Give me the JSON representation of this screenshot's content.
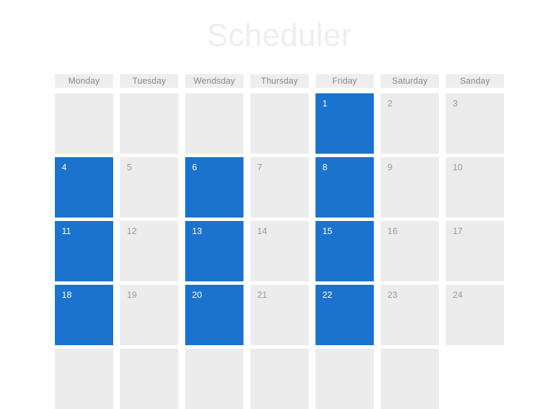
{
  "app": {
    "title": "Scheduler",
    "background_color": "#ffffff",
    "title_color": "#eeeeee"
  },
  "colors": {
    "selected_day": "#1b73cd",
    "day_cell": "#ececec",
    "weekday_header": "#eeeeee",
    "day_text": "#999999",
    "selected_day_text": "#ffffff",
    "weekday_text": "#888888"
  },
  "calendar": {
    "weekdays": [
      {
        "label": "Monday"
      },
      {
        "label": "Tuesday"
      },
      {
        "label": "Wendsday"
      },
      {
        "label": "Thursday"
      },
      {
        "label": "Friday"
      },
      {
        "label": "Saturday"
      },
      {
        "label": "Sanday"
      }
    ],
    "weeks": [
      {
        "days": [
          {
            "num": "",
            "state": "blank"
          },
          {
            "num": "",
            "state": "blank"
          },
          {
            "num": "",
            "state": "blank"
          },
          {
            "num": "",
            "state": "blank"
          },
          {
            "num": "1",
            "state": "selected"
          },
          {
            "num": "2",
            "state": "normal"
          },
          {
            "num": "3",
            "state": "normal"
          }
        ]
      },
      {
        "days": [
          {
            "num": "4",
            "state": "selected"
          },
          {
            "num": "5",
            "state": "normal"
          },
          {
            "num": "6",
            "state": "selected"
          },
          {
            "num": "7",
            "state": "normal"
          },
          {
            "num": "8",
            "state": "selected"
          },
          {
            "num": "9",
            "state": "normal"
          },
          {
            "num": "10",
            "state": "normal"
          }
        ]
      },
      {
        "days": [
          {
            "num": "11",
            "state": "selected"
          },
          {
            "num": "12",
            "state": "normal"
          },
          {
            "num": "13",
            "state": "selected"
          },
          {
            "num": "14",
            "state": "normal"
          },
          {
            "num": "15",
            "state": "selected"
          },
          {
            "num": "16",
            "state": "normal"
          },
          {
            "num": "17",
            "state": "normal"
          }
        ]
      },
      {
        "days": [
          {
            "num": "18",
            "state": "selected"
          },
          {
            "num": "19",
            "state": "normal"
          },
          {
            "num": "20",
            "state": "selected"
          },
          {
            "num": "21",
            "state": "normal"
          },
          {
            "num": "22",
            "state": "selected"
          },
          {
            "num": "23",
            "state": "normal"
          },
          {
            "num": "24",
            "state": "normal"
          }
        ]
      },
      {
        "days": [
          {
            "num": "",
            "state": "blank"
          },
          {
            "num": "",
            "state": "blank"
          },
          {
            "num": "",
            "state": "blank"
          },
          {
            "num": "",
            "state": "blank"
          },
          {
            "num": "",
            "state": "blank"
          },
          {
            "num": "",
            "state": "blank"
          },
          {
            "num": "",
            "state": "hidden"
          }
        ]
      }
    ]
  }
}
